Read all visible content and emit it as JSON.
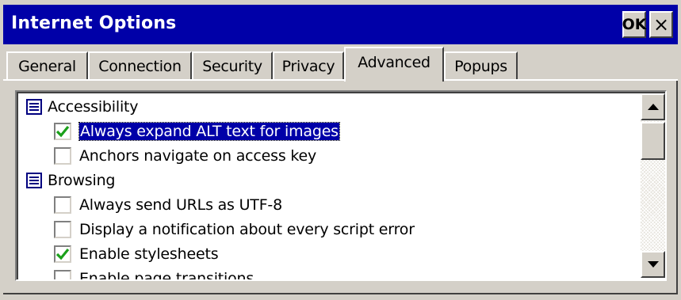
{
  "window": {
    "title": "Internet Options",
    "ok_label": "OK",
    "close_label": "×"
  },
  "tabs": [
    {
      "label": "General",
      "active": false
    },
    {
      "label": "Connection",
      "active": false
    },
    {
      "label": "Security",
      "active": false
    },
    {
      "label": "Privacy",
      "active": false
    },
    {
      "label": "Advanced",
      "active": true
    },
    {
      "label": "Popups",
      "active": false
    }
  ],
  "settings": [
    {
      "type": "category",
      "label": "Accessibility",
      "icon": "settings-category-icon"
    },
    {
      "type": "option",
      "label": "Always expand ALT text for images",
      "checked": true,
      "selected": true
    },
    {
      "type": "option",
      "label": "Anchors navigate on access key",
      "checked": false,
      "selected": false
    },
    {
      "type": "category",
      "label": "Browsing",
      "icon": "settings-category-icon"
    },
    {
      "type": "option",
      "label": "Always send URLs as UTF-8",
      "checked": false,
      "selected": false
    },
    {
      "type": "option",
      "label": "Display a notification about every script error",
      "checked": false,
      "selected": false
    },
    {
      "type": "option",
      "label": "Enable stylesheets",
      "checked": true,
      "selected": false
    },
    {
      "type": "option",
      "label": "Enable page transitions",
      "checked": false,
      "selected": false
    }
  ],
  "colors": {
    "titlebar": "#0000a8",
    "face": "#d4d0c8",
    "selection": "#0000a8",
    "checkmark": "#1aa01a"
  }
}
